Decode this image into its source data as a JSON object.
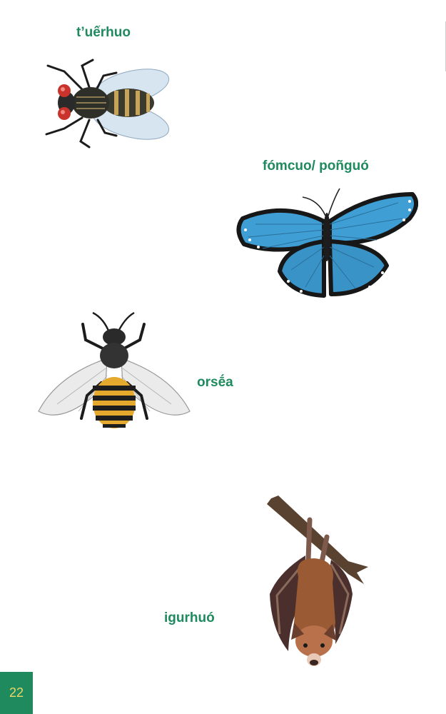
{
  "labels": {
    "fly": "t’uếrhuo",
    "butterfly": "fómcuo/ poñguó",
    "bee": "orsḗa",
    "bat": "igurhuó"
  },
  "page_number": "22",
  "colors": {
    "label_green": "#1e8a5e",
    "page_box": "#1f8a5d",
    "page_number_text": "#e9d86a"
  },
  "illustrations": [
    "fly-illustration",
    "butterfly-illustration",
    "bee-illustration",
    "bat-illustration"
  ]
}
